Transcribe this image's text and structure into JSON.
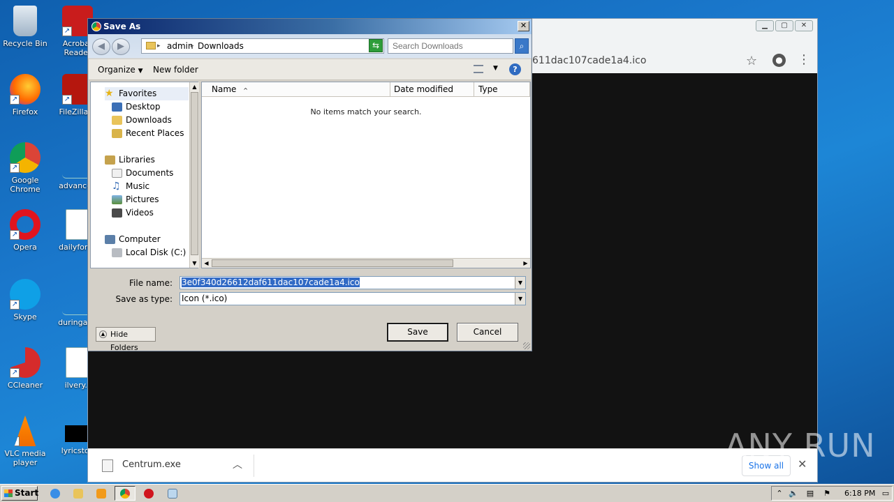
{
  "desktop": {
    "icons": [
      {
        "label": "Recycle Bin"
      },
      {
        "label": "Acrobat Reader"
      },
      {
        "label": "Firefox"
      },
      {
        "label": "FileZilla C"
      },
      {
        "label": "Google Chrome"
      },
      {
        "label": "advanced"
      },
      {
        "label": "Opera"
      },
      {
        "label": "dailyforce"
      },
      {
        "label": "Skype"
      },
      {
        "label": "duringany"
      },
      {
        "label": "CCleaner"
      },
      {
        "label": "ilvery.r"
      },
      {
        "label": "VLC media player"
      },
      {
        "label": "lyricstoo"
      }
    ]
  },
  "browser": {
    "address_fragment": "611dac107cade1a4.ico",
    "download_bar": {
      "file_name": "Centrum.exe",
      "show_all_label": "Show all"
    }
  },
  "watermark": "ANY RUN",
  "dialog": {
    "title": "Save As",
    "breadcrumb": {
      "part1": "admin",
      "part2": "Downloads"
    },
    "search_placeholder": "Search Downloads",
    "toolbar": {
      "organize": "Organize",
      "new_folder": "New folder"
    },
    "nav": {
      "favorites": "Favorites",
      "desktop": "Desktop",
      "downloads": "Downloads",
      "recent_places": "Recent Places",
      "libraries": "Libraries",
      "documents": "Documents",
      "music": "Music",
      "pictures": "Pictures",
      "videos": "Videos",
      "computer": "Computer",
      "local_disk": "Local Disk (C:)"
    },
    "columns": {
      "name": "Name",
      "date_modified": "Date modified",
      "type": "Type"
    },
    "empty_message": "No items match your search.",
    "file_name_label": "File name:",
    "file_name_value": "3e0f340d26612daf611dac107cade1a4.ico",
    "save_type_label": "Save as type:",
    "save_type_value": "Icon (*.ico)",
    "save_label": "Save",
    "cancel_label": "Cancel",
    "hide_folders_label": "Hide Folders"
  },
  "taskbar": {
    "start_label": "Start",
    "clock": "6:18 PM"
  }
}
